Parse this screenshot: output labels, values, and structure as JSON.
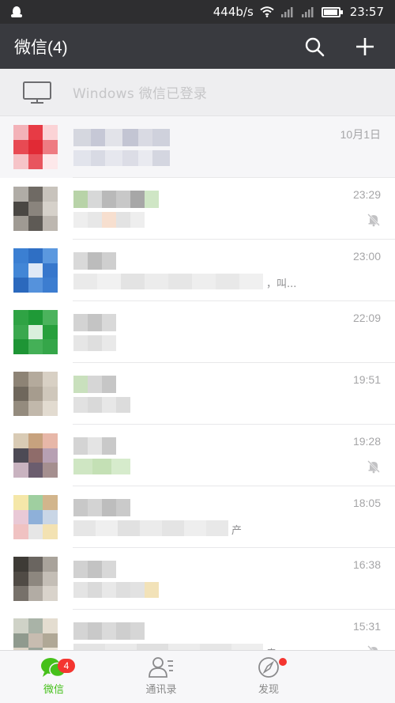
{
  "status_bar": {
    "speed": "444b/s",
    "time": "23:57"
  },
  "header": {
    "title": "微信(4)",
    "search_icon": "search-icon",
    "add_icon": "plus-icon"
  },
  "login_bar": {
    "text": "Windows 微信已登录",
    "icon": "monitor-icon"
  },
  "chats": [
    {
      "time": "10月1日",
      "muted": false,
      "pinned": true,
      "tail": "",
      "avatar": [
        "#f3b2b8",
        "#e73b45",
        "#fbd3d6",
        "#e84a53",
        "#e12a35",
        "#ee7b82",
        "#f6c4c8",
        "#e8555e",
        "#fde8ea"
      ],
      "name": [
        "#d5d7df",
        "#c6c8d6",
        "#e2e3e9",
        "#c3c5d3",
        "#d9dae3",
        "#cfd1dc"
      ],
      "preview": [
        "#e2e4ec",
        "#d8dae4",
        "#e6e7ee",
        "#dcdde6",
        "#e9eaf0",
        "#d4d6e0"
      ]
    },
    {
      "time": "23:29",
      "muted": true,
      "pinned": false,
      "tail": "",
      "avatar": [
        "#b0aca6",
        "#6f6a64",
        "#c8c3bc",
        "#4a4743",
        "#8a847d",
        "#d6d1ca",
        "#9f9a93",
        "#5e5a55",
        "#bdb7b0"
      ],
      "name": [
        "#b8d3a8",
        "#d7d8d8",
        "#b9b9b9",
        "#c8c8c8",
        "#a7a7a7",
        "#cfe6c5"
      ],
      "preview": [
        "#eeeeee",
        "#e7e7e7",
        "#f7dfcf",
        "#e3e3e3",
        "#eeeeee"
      ]
    },
    {
      "time": "23:00",
      "muted": false,
      "pinned": false,
      "tail": "，叫...",
      "avatar": [
        "#3b7fd2",
        "#2f6fc4",
        "#5b98df",
        "#4286d6",
        "#dfe9f6",
        "#3777cc",
        "#2b69bd",
        "#5592dc",
        "#3c7dd0"
      ],
      "name": [
        "#d9d9d9",
        "#bcbcbc",
        "#cfcfcf"
      ],
      "preview": [
        "#eaeaea",
        "#f1f1f1",
        "#e3e3e3",
        "#ececec",
        "#e6e6e6",
        "#eeeeee",
        "#e8e8e8",
        "#f0f0f0"
      ]
    },
    {
      "time": "22:09",
      "muted": false,
      "pinned": false,
      "tail": "",
      "avatar": [
        "#2fa344",
        "#1f9a37",
        "#4bb35c",
        "#3aa84e",
        "#d9efdc",
        "#27a03c",
        "#1e9535",
        "#44b057",
        "#35a649"
      ],
      "name": [
        "#d3d3d3",
        "#c4c4c4",
        "#d9d9d9"
      ],
      "preview": [
        "#e6e6e6",
        "#dedede",
        "#e9e9e9"
      ]
    },
    {
      "time": "19:51",
      "muted": false,
      "pinned": false,
      "tail": "",
      "avatar": [
        "#8d8375",
        "#b4aa9c",
        "#d8d0c4",
        "#6f675c",
        "#a69c8e",
        "#cfc7bb",
        "#948b7e",
        "#c1b8ab",
        "#e2dbd0"
      ],
      "name": [
        "#c9e0bd",
        "#d6d6d6",
        "#c6c6c6"
      ],
      "preview": [
        "#e1e1e1",
        "#d9d9d9",
        "#e7e7e7",
        "#dcdcdc"
      ]
    },
    {
      "time": "19:28",
      "muted": true,
      "pinned": false,
      "tail": "",
      "avatar": [
        "#d9cbb5",
        "#c7a27e",
        "#e7b7a8",
        "#4d4a55",
        "#8f6c6a",
        "#b7a0b3",
        "#c9b3c0",
        "#6b5d6e",
        "#a58f8f"
      ],
      "name": [
        "#d4d4d4",
        "#e4e4e4",
        "#c9c9c9"
      ],
      "preview": [
        "#cfe6c3",
        "#c4e0b5",
        "#d6ebcc"
      ]
    },
    {
      "time": "18:05",
      "muted": false,
      "pinned": false,
      "tail": "产",
      "avatar": [
        "#f5e7a9",
        "#9fcfa0",
        "#d2b58c",
        "#e9c9d6",
        "#8eb0d9",
        "#c9d6e6",
        "#f0c2c2",
        "#e6e6e6",
        "#f3e2b2"
      ],
      "name": [
        "#c8c8c8",
        "#d3d3d3",
        "#bdbdbd",
        "#cacaca"
      ],
      "preview": [
        "#e6e6e6",
        "#efefef",
        "#e1e1e1",
        "#ebebeb",
        "#e4e4e4",
        "#eeeeee",
        "#e8e8e8"
      ]
    },
    {
      "time": "16:38",
      "muted": false,
      "pinned": false,
      "tail": "",
      "avatar": [
        "#3e3b36",
        "#6a6560",
        "#a9a39b",
        "#504b45",
        "#8d877f",
        "#c4beb6",
        "#77716a",
        "#b2aca4",
        "#d9d3cb"
      ],
      "name": [
        "#d1d1d1",
        "#c3c3c3",
        "#d8d8d8"
      ],
      "preview": [
        "#e4e4e4",
        "#dadada",
        "#e8e8e8",
        "#dedede",
        "#e2e2e2",
        "#f2e2b8"
      ]
    },
    {
      "time": "15:31",
      "muted": true,
      "pinned": false,
      "tail": "卖",
      "avatar": [
        "#cfd2c7",
        "#a9b3a7",
        "#e4ddd0",
        "#8f9a8e",
        "#c7bcb0",
        "#b0a896",
        "#dbd3c5",
        "#9aa49a",
        "#ece5d8"
      ],
      "name": [
        "#d4d4d4",
        "#c9c9c9",
        "#dadada",
        "#cecece",
        "#d6d6d6"
      ],
      "preview": [
        "#e4e4e4",
        "#eaeaea",
        "#e0e0e0",
        "#ececec",
        "#e6e6e6",
        "#eeeeee"
      ]
    }
  ],
  "tabs": [
    {
      "label": "微信",
      "badge": "4",
      "icon": "chat-bubble-icon",
      "active": true
    },
    {
      "label": "通讯录",
      "badge": "",
      "icon": "contacts-icon",
      "active": false
    },
    {
      "label": "发现",
      "badge": "",
      "icon": "compass-icon",
      "active": false
    }
  ],
  "colors": {
    "header_bg": "#393a3f",
    "accent_green": "#45c01a",
    "badge_red": "#f43530"
  }
}
